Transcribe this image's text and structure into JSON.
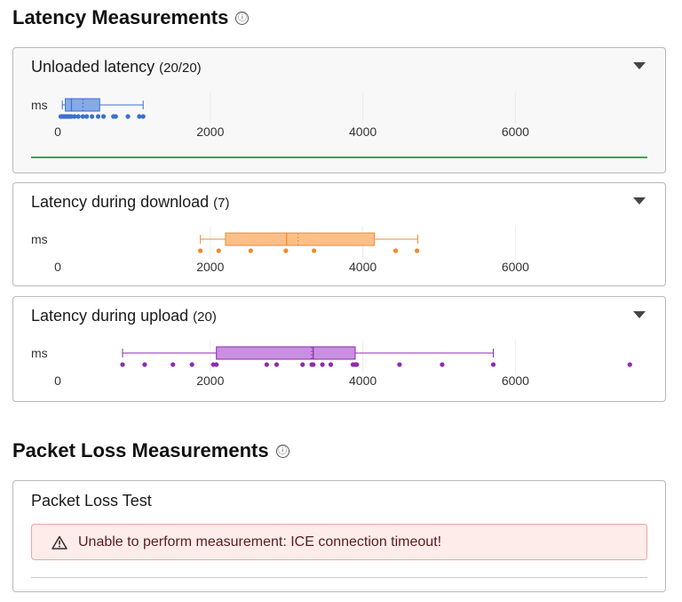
{
  "latency": {
    "title": "Latency Measurements",
    "info_glyph": "ⓘ",
    "x_axis": {
      "min": 0,
      "max": 7800,
      "ticks": [
        0,
        2000,
        4000,
        6000
      ],
      "unit": "ms"
    },
    "cards": [
      {
        "title": "Unloaded latency",
        "count": "(20/20)",
        "color": "#3b6fd0",
        "fill": "#86aae6",
        "box": {
          "min": 60,
          "q1": 100,
          "median": 180,
          "mean": 330,
          "q3": 550,
          "max": 1120
        },
        "points": [
          40,
          60,
          80,
          100,
          120,
          140,
          160,
          180,
          220,
          270,
          330,
          380,
          450,
          530,
          600,
          730,
          760,
          920,
          1070,
          1120
        ]
      },
      {
        "title": "Latency during download",
        "count": "(7)",
        "color": "#f08a2c",
        "fill": "#fbbf8c",
        "box": {
          "min": 1870,
          "q1": 2200,
          "median": 3000,
          "mean": 3150,
          "q3": 4150,
          "max": 4720
        },
        "points": [
          1870,
          2110,
          2530,
          2990,
          3360,
          4430,
          4710
        ]
      },
      {
        "title": "Latency during upload",
        "count": "(20)",
        "color": "#8e2bb0",
        "fill": "#c98fe0",
        "box": {
          "min": 850,
          "q1": 2080,
          "median": 3350,
          "mean": 3330,
          "q3": 3900,
          "max": 5710
        },
        "points": [
          850,
          1140,
          1510,
          1760,
          2040,
          2080,
          2740,
          2870,
          3210,
          3330,
          3350,
          3470,
          3580,
          3870,
          3900,
          3920,
          4480,
          5040,
          5710,
          7500
        ]
      }
    ]
  },
  "packet_loss": {
    "title": "Packet Loss Measurements",
    "info_glyph": "ⓘ",
    "card": {
      "title": "Packet Loss Test",
      "alert": "Unable to perform measurement: ICE connection timeout!"
    }
  }
}
